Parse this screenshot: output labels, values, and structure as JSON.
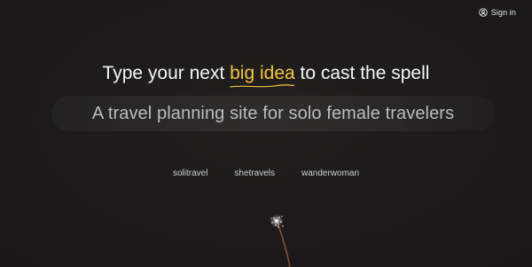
{
  "header": {
    "signin_label": "Sign in",
    "signin_icon": "user-circle-icon"
  },
  "hero": {
    "headline_prefix": "Type your next ",
    "headline_highlight": "big idea",
    "headline_suffix": " to cast the spell",
    "highlight_color": "#f5c542"
  },
  "idea_input": {
    "value": "A travel planning site for solo female travelers",
    "placeholder": ""
  },
  "suggestions": [
    {
      "label": "solitravel"
    },
    {
      "label": "shetravels"
    },
    {
      "label": "wanderwoman"
    }
  ],
  "decor": {
    "sparkle_icon": "magic-wand-sparkle-icon",
    "background_color": "#1e1b1b"
  }
}
